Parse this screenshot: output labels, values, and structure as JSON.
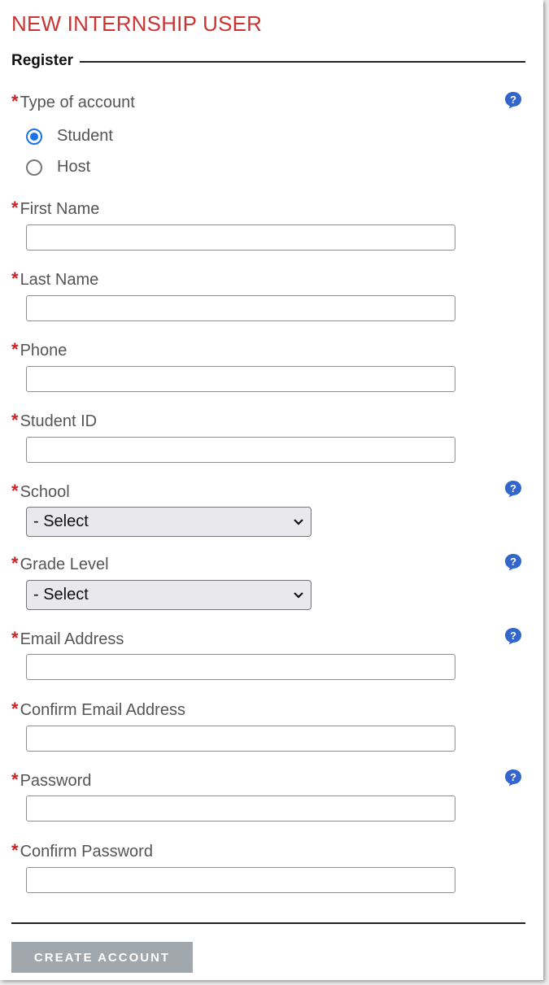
{
  "page": {
    "title": "NEW INTERNSHIP USER",
    "legend": "Register",
    "required_marker": "*"
  },
  "fields": {
    "account_type": {
      "label": "Type of account",
      "options": [
        {
          "label": "Student",
          "checked": true
        },
        {
          "label": "Host",
          "checked": false
        }
      ]
    },
    "first_name": {
      "label": "First Name",
      "value": ""
    },
    "last_name": {
      "label": "Last Name",
      "value": ""
    },
    "phone": {
      "label": "Phone",
      "value": ""
    },
    "student_id": {
      "label": "Student ID",
      "value": ""
    },
    "school": {
      "label": "School",
      "selected": "- Select"
    },
    "grade_level": {
      "label": "Grade Level",
      "selected": "- Select"
    },
    "email": {
      "label": "Email Address",
      "value": ""
    },
    "confirm_email": {
      "label": "Confirm Email Address",
      "value": ""
    },
    "password": {
      "label": "Password",
      "value": ""
    },
    "confirm_password": {
      "label": "Confirm Password",
      "value": ""
    }
  },
  "actions": {
    "create_account": "CREATE ACCOUNT"
  },
  "icons": {
    "help": "help-question-icon",
    "dropdown": "chevron-down-icon"
  },
  "colors": {
    "title": "#cc3333",
    "required": "#cc2222",
    "help": "#3366cc",
    "radio_accent": "#1a73e8",
    "button_bg": "#a0a8ad"
  }
}
